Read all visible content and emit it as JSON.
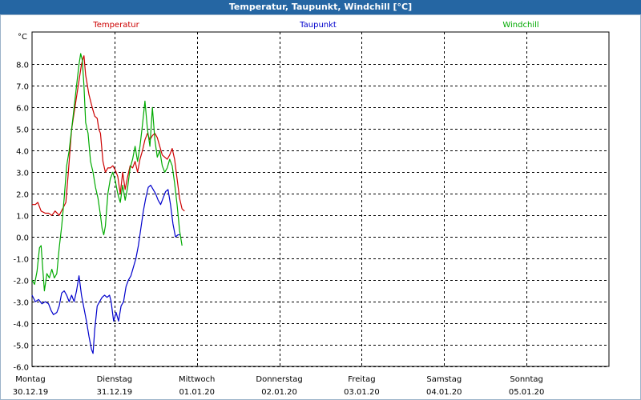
{
  "window": {
    "title": "Temperatur, Taupunkt, Windchill [°C]"
  },
  "chart_data": {
    "type": "line",
    "title": "Temperatur, Taupunkt, Windchill [°C]",
    "ylabel": "°C",
    "ylim": [
      -6.0,
      9.5
    ],
    "yticks": [
      "8.0",
      "7.0",
      "6.0",
      "5.0",
      "4.0",
      "3.0",
      "2.0",
      "1.0",
      "0.0",
      "-1.0",
      "-2.0",
      "-3.0",
      "-4.0",
      "-5.0",
      "-6.0"
    ],
    "ytick_values": [
      8,
      7,
      6,
      5,
      4,
      3,
      2,
      1,
      0,
      -1,
      -2,
      -3,
      -4,
      -5,
      -6
    ],
    "xlim": [
      0,
      7
    ],
    "grid": true,
    "legend_position": "top",
    "days": [
      {
        "name": "Montag",
        "date": "30.12.19",
        "x": 0
      },
      {
        "name": "Dienstag",
        "date": "31.12.19",
        "x": 1
      },
      {
        "name": "Mittwoch",
        "date": "01.01.20",
        "x": 2
      },
      {
        "name": "Donnerstag",
        "date": "02.01.20",
        "x": 3
      },
      {
        "name": "Freitag",
        "date": "03.01.20",
        "x": 4
      },
      {
        "name": "Samstag",
        "date": "04.01.20",
        "x": 5
      },
      {
        "name": "Sonntag",
        "date": "05.01.20",
        "x": 6
      }
    ],
    "series": [
      {
        "name": "Temperatur",
        "color": "#cc0000",
        "points": [
          [
            0.0,
            1.5
          ],
          [
            0.04,
            1.5
          ],
          [
            0.07,
            1.6
          ],
          [
            0.11,
            1.2
          ],
          [
            0.16,
            1.1
          ],
          [
            0.2,
            1.1
          ],
          [
            0.24,
            1.0
          ],
          [
            0.28,
            1.2
          ],
          [
            0.33,
            1.0
          ],
          [
            0.37,
            1.3
          ],
          [
            0.41,
            1.6
          ],
          [
            0.44,
            3.0
          ],
          [
            0.48,
            5.0
          ],
          [
            0.52,
            6.0
          ],
          [
            0.56,
            7.0
          ],
          [
            0.6,
            8.0
          ],
          [
            0.62,
            8.3
          ],
          [
            0.63,
            8.4
          ],
          [
            0.65,
            7.5
          ],
          [
            0.69,
            6.6
          ],
          [
            0.73,
            6.0
          ],
          [
            0.76,
            5.6
          ],
          [
            0.79,
            5.5
          ],
          [
            0.81,
            5.0
          ],
          [
            0.83,
            4.8
          ],
          [
            0.86,
            3.5
          ],
          [
            0.89,
            3.0
          ],
          [
            0.92,
            3.2
          ],
          [
            0.95,
            3.2
          ],
          [
            0.98,
            3.3
          ],
          [
            1.01,
            3.1
          ],
          [
            1.04,
            2.8
          ],
          [
            1.07,
            2.0
          ],
          [
            1.1,
            3.0
          ],
          [
            1.13,
            2.2
          ],
          [
            1.16,
            2.8
          ],
          [
            1.19,
            3.3
          ],
          [
            1.22,
            3.2
          ],
          [
            1.25,
            3.5
          ],
          [
            1.28,
            3.0
          ],
          [
            1.31,
            3.6
          ],
          [
            1.34,
            4.0
          ],
          [
            1.37,
            4.5
          ],
          [
            1.4,
            4.8
          ],
          [
            1.43,
            4.5
          ],
          [
            1.46,
            4.7
          ],
          [
            1.49,
            4.8
          ],
          [
            1.52,
            4.6
          ],
          [
            1.55,
            4.2
          ],
          [
            1.58,
            3.8
          ],
          [
            1.61,
            3.7
          ],
          [
            1.64,
            3.6
          ],
          [
            1.67,
            3.8
          ],
          [
            1.7,
            4.1
          ],
          [
            1.73,
            3.6
          ],
          [
            1.76,
            2.7
          ],
          [
            1.79,
            1.8
          ],
          [
            1.82,
            1.3
          ],
          [
            1.85,
            1.2
          ]
        ]
      },
      {
        "name": "Taupunkt",
        "color": "#0000cc",
        "points": [
          [
            0.0,
            -2.7
          ],
          [
            0.04,
            -3.0
          ],
          [
            0.08,
            -2.9
          ],
          [
            0.12,
            -3.1
          ],
          [
            0.16,
            -3.0
          ],
          [
            0.2,
            -3.1
          ],
          [
            0.23,
            -3.4
          ],
          [
            0.26,
            -3.6
          ],
          [
            0.3,
            -3.5
          ],
          [
            0.33,
            -3.2
          ],
          [
            0.36,
            -2.6
          ],
          [
            0.39,
            -2.5
          ],
          [
            0.42,
            -2.7
          ],
          [
            0.45,
            -3.0
          ],
          [
            0.48,
            -2.7
          ],
          [
            0.51,
            -3.0
          ],
          [
            0.54,
            -2.5
          ],
          [
            0.57,
            -1.8
          ],
          [
            0.6,
            -2.7
          ],
          [
            0.63,
            -3.3
          ],
          [
            0.66,
            -3.9
          ],
          [
            0.69,
            -4.6
          ],
          [
            0.72,
            -5.2
          ],
          [
            0.74,
            -5.4
          ],
          [
            0.76,
            -4.3
          ],
          [
            0.79,
            -3.2
          ],
          [
            0.82,
            -3.0
          ],
          [
            0.85,
            -2.8
          ],
          [
            0.88,
            -2.7
          ],
          [
            0.91,
            -2.8
          ],
          [
            0.94,
            -2.7
          ],
          [
            0.96,
            -3.0
          ],
          [
            0.99,
            -3.9
          ],
          [
            1.02,
            -3.5
          ],
          [
            1.05,
            -3.9
          ],
          [
            1.08,
            -3.2
          ],
          [
            1.11,
            -3.0
          ],
          [
            1.14,
            -2.3
          ],
          [
            1.17,
            -2.0
          ],
          [
            1.2,
            -1.8
          ],
          [
            1.23,
            -1.4
          ],
          [
            1.26,
            -1.0
          ],
          [
            1.29,
            -0.4
          ],
          [
            1.32,
            0.4
          ],
          [
            1.35,
            1.2
          ],
          [
            1.38,
            1.8
          ],
          [
            1.41,
            2.3
          ],
          [
            1.44,
            2.4
          ],
          [
            1.47,
            2.2
          ],
          [
            1.5,
            2.0
          ],
          [
            1.53,
            1.7
          ],
          [
            1.56,
            1.5
          ],
          [
            1.59,
            1.8
          ],
          [
            1.62,
            2.1
          ],
          [
            1.65,
            2.2
          ],
          [
            1.68,
            1.5
          ],
          [
            1.71,
            0.6
          ],
          [
            1.74,
            0.0
          ],
          [
            1.77,
            0.1
          ],
          [
            1.8,
            0.1
          ]
        ]
      },
      {
        "name": "Windchill",
        "color": "#00aa00",
        "points": [
          [
            0.0,
            -2.0
          ],
          [
            0.03,
            -2.2
          ],
          [
            0.06,
            -1.6
          ],
          [
            0.09,
            -0.5
          ],
          [
            0.11,
            -0.4
          ],
          [
            0.13,
            -1.5
          ],
          [
            0.15,
            -2.5
          ],
          [
            0.18,
            -1.7
          ],
          [
            0.21,
            -1.9
          ],
          [
            0.24,
            -1.5
          ],
          [
            0.27,
            -1.9
          ],
          [
            0.3,
            -1.7
          ],
          [
            0.33,
            -0.5
          ],
          [
            0.36,
            0.5
          ],
          [
            0.39,
            1.8
          ],
          [
            0.42,
            3.3
          ],
          [
            0.45,
            4.0
          ],
          [
            0.48,
            5.0
          ],
          [
            0.51,
            6.0
          ],
          [
            0.54,
            7.0
          ],
          [
            0.57,
            8.0
          ],
          [
            0.59,
            8.5
          ],
          [
            0.61,
            8.2
          ],
          [
            0.63,
            7.0
          ],
          [
            0.65,
            5.3
          ],
          [
            0.68,
            4.8
          ],
          [
            0.71,
            3.5
          ],
          [
            0.74,
            3.0
          ],
          [
            0.77,
            2.3
          ],
          [
            0.8,
            1.8
          ],
          [
            0.83,
            1.0
          ],
          [
            0.85,
            0.4
          ],
          [
            0.87,
            0.1
          ],
          [
            0.89,
            0.5
          ],
          [
            0.92,
            2.0
          ],
          [
            0.95,
            2.7
          ],
          [
            0.98,
            3.0
          ],
          [
            1.01,
            2.6
          ],
          [
            1.04,
            2.0
          ],
          [
            1.07,
            1.6
          ],
          [
            1.1,
            2.4
          ],
          [
            1.13,
            1.7
          ],
          [
            1.16,
            2.3
          ],
          [
            1.19,
            3.2
          ],
          [
            1.22,
            3.6
          ],
          [
            1.25,
            4.2
          ],
          [
            1.28,
            3.5
          ],
          [
            1.31,
            4.2
          ],
          [
            1.34,
            5.2
          ],
          [
            1.37,
            6.3
          ],
          [
            1.4,
            5.0
          ],
          [
            1.43,
            4.2
          ],
          [
            1.46,
            6.0
          ],
          [
            1.49,
            4.5
          ],
          [
            1.52,
            3.7
          ],
          [
            1.55,
            4.0
          ],
          [
            1.58,
            3.3
          ],
          [
            1.61,
            3.0
          ],
          [
            1.64,
            3.2
          ],
          [
            1.67,
            3.6
          ],
          [
            1.7,
            3.3
          ],
          [
            1.73,
            2.5
          ],
          [
            1.76,
            1.5
          ],
          [
            1.79,
            0.3
          ],
          [
            1.82,
            -0.4
          ]
        ]
      }
    ]
  }
}
